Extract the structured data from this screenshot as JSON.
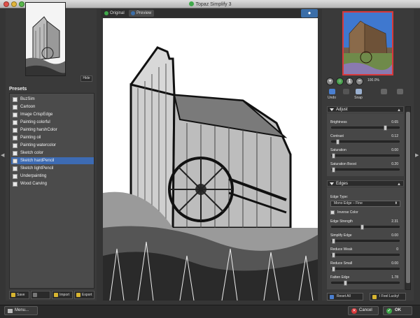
{
  "window": {
    "title": "Topaz Simplify 3"
  },
  "left_panel": {
    "hide_label": "Hide",
    "presets_title": "Presets",
    "presets": [
      {
        "label": "BuzSim",
        "selected": false
      },
      {
        "label": "Cartoon",
        "selected": false
      },
      {
        "label": "Image CrispEdge",
        "selected": false
      },
      {
        "label": "Painting colorful",
        "selected": false
      },
      {
        "label": "Painting harshColor",
        "selected": false
      },
      {
        "label": "Painting oil",
        "selected": false
      },
      {
        "label": "Painting watercolor",
        "selected": false
      },
      {
        "label": "Sketch color",
        "selected": false
      },
      {
        "label": "Sketch hardPencil",
        "selected": true
      },
      {
        "label": "Sketch lightPencil",
        "selected": false
      },
      {
        "label": "Underpainting",
        "selected": false
      },
      {
        "label": "Wood Carving",
        "selected": false
      }
    ],
    "buttons": {
      "save": "Save",
      "import": "Import",
      "export": "Export"
    }
  },
  "main": {
    "tabs": [
      {
        "label": "Original",
        "dot_color": "#3fa84a"
      },
      {
        "label": "Preview",
        "dot_color": "#3b6ea8"
      }
    ]
  },
  "right_panel": {
    "zoom_level": "100.0%",
    "tools": {
      "undo": "Undo",
      "snap": "Snap"
    },
    "adjust": {
      "title": "Adjust",
      "sliders": [
        {
          "label": "Brightness",
          "value": "0.65",
          "fraction": 0.8
        },
        {
          "label": "Contrast",
          "value": "0.12",
          "fraction": 0.06
        },
        {
          "label": "Saturation",
          "value": "0.00",
          "fraction": 0.0
        },
        {
          "label": "Saturation Boost",
          "value": "0.20",
          "fraction": 0.0
        }
      ]
    },
    "edges": {
      "title": "Edges",
      "edge_type_label": "Edge Type:",
      "edge_type_value": "Mono Edge – Fine",
      "inverse_color_label": "Inverse Color",
      "inverse_color_checked": false,
      "sliders": [
        {
          "label": "Edge Strength",
          "value": "2.31",
          "fraction": 0.45
        },
        {
          "label": "Simplify Edge",
          "value": "0.00",
          "fraction": 0.0
        },
        {
          "label": "Reduce Weak",
          "value": "0",
          "fraction": 0.0
        },
        {
          "label": "Reduce Small",
          "value": "0.00",
          "fraction": 0.0
        },
        {
          "label": "Fatten Edge",
          "value": "1.78",
          "fraction": 0.18
        }
      ]
    },
    "buttons": {
      "reset_all": "Reset All",
      "feel_lucky": "I Feel Lucky!"
    }
  },
  "bottom_bar": {
    "menu": "Menu...",
    "cancel": "Cancel",
    "ok": "OK"
  },
  "colors": {
    "accent": "#3d6bb3",
    "cancel": "#d9383a",
    "ok": "#3fa84a"
  }
}
